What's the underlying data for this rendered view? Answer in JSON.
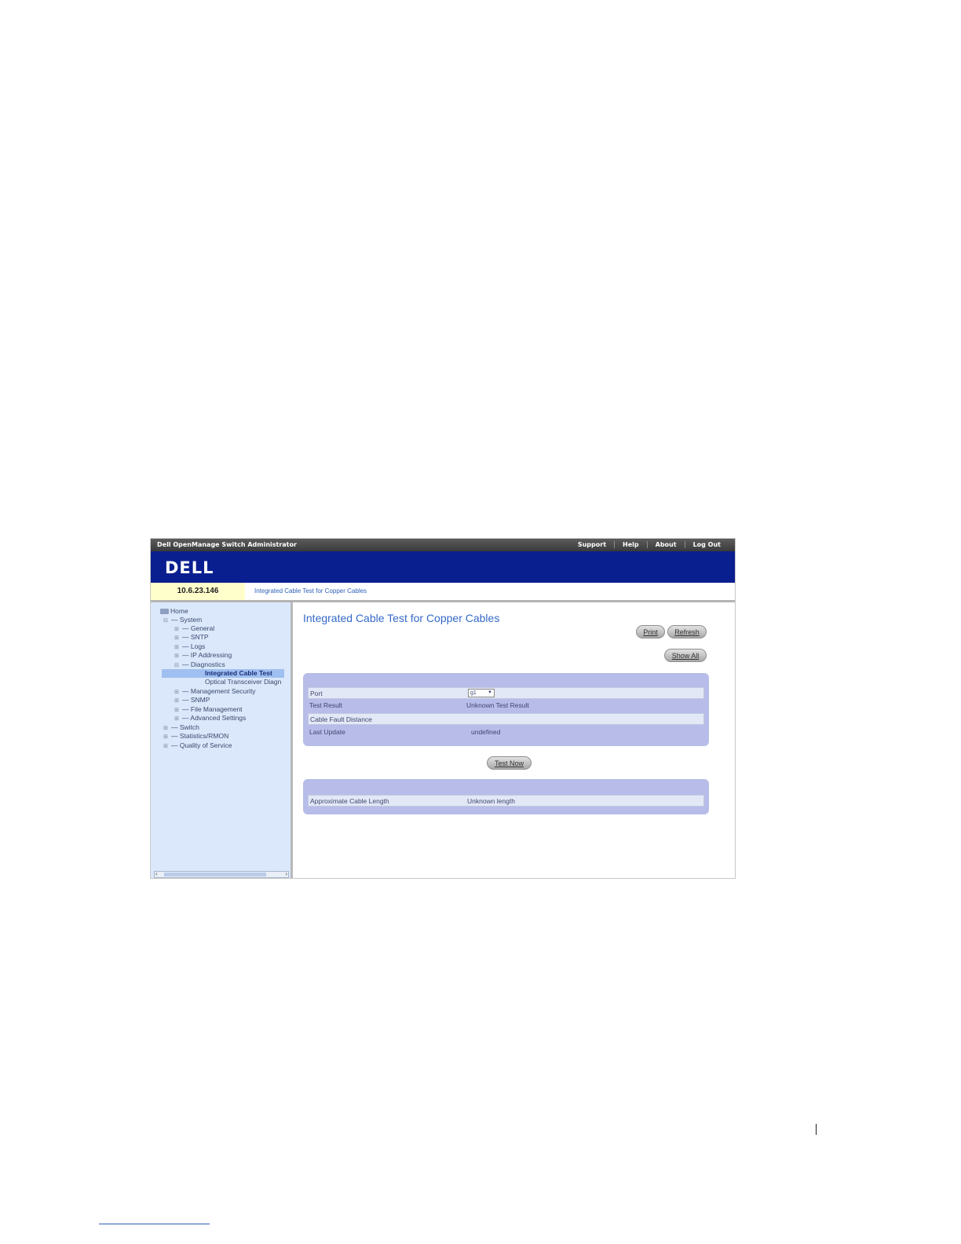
{
  "window": {
    "app_title": "Dell OpenManage Switch Administrator",
    "top_links": [
      "Support",
      "Help",
      "About",
      "Log Out"
    ],
    "logo_text": "DELL",
    "ip_address": "10.6.23.146",
    "breadcrumb": "Integrated Cable Test for Copper Cables"
  },
  "sidebar": {
    "tree": [
      {
        "label": "Home",
        "level": 0,
        "icon": "folder-icon"
      },
      {
        "label": "System",
        "level": 1,
        "expander": "⊟"
      },
      {
        "label": "General",
        "level": 2,
        "expander": "⊞"
      },
      {
        "label": "SNTP",
        "level": 2,
        "expander": "⊞"
      },
      {
        "label": "Logs",
        "level": 2,
        "expander": "⊞"
      },
      {
        "label": "IP Addressing",
        "level": 2,
        "expander": "⊞"
      },
      {
        "label": "Diagnostics",
        "level": 2,
        "expander": "⊟"
      },
      {
        "label": "Integrated Cable Test",
        "level": 3,
        "selected": true
      },
      {
        "label": "Optical Transceiver Diagn",
        "level": 3
      },
      {
        "label": "Management Security",
        "level": 2,
        "expander": "⊞"
      },
      {
        "label": "SNMP",
        "level": 2,
        "expander": "⊞"
      },
      {
        "label": "File Management",
        "level": 2,
        "expander": "⊞"
      },
      {
        "label": "Advanced Settings",
        "level": 2,
        "expander": "⊞"
      },
      {
        "label": "Switch",
        "level": 1,
        "expander": "⊞"
      },
      {
        "label": "Statistics/RMON",
        "level": 1,
        "expander": "⊞"
      },
      {
        "label": "Quality of Service",
        "level": 1,
        "expander": "⊞"
      }
    ]
  },
  "main": {
    "title": "Integrated Cable Test for Copper Cables",
    "buttons": {
      "print": "Print",
      "refresh": "Refresh",
      "show_all": "Show All",
      "test_now": "Test Now"
    },
    "test_panel": {
      "port_label": "Port",
      "port_value": "g1",
      "test_result_label": "Test Result",
      "test_result_value": "Unknown Test Result",
      "cable_fault_label": "Cable Fault Distance",
      "last_update_label": "Last Update",
      "last_update_value": "undefined"
    },
    "length_panel": {
      "length_label": "Approximate Cable Length",
      "length_value": "Unknown length"
    }
  },
  "colors": {
    "banner": "#0a1f8f",
    "panel": "#b7bde8",
    "sidebar": "#dbe8fb",
    "title": "#3569c9"
  }
}
